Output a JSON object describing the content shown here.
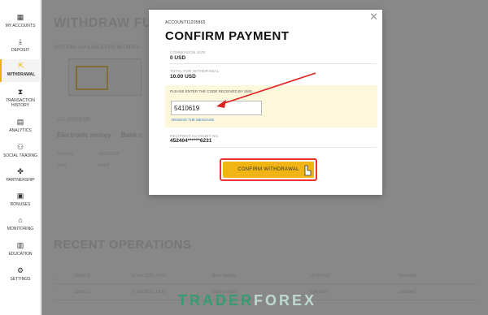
{
  "sidebar": {
    "items": [
      {
        "label": "MY ACCOUNTS",
        "icon": "grid-icon"
      },
      {
        "label": "DEPOSIT",
        "icon": "download-icon"
      },
      {
        "label": "WITHDRAWAL",
        "icon": "withdrawal-icon",
        "active": true
      },
      {
        "label": "TRANSACTION HISTORY",
        "icon": "hourglass-icon"
      },
      {
        "label": "ANALYTICS",
        "icon": "chat-icon"
      },
      {
        "label": "SOCIAL TRADING",
        "icon": "people-icon"
      },
      {
        "label": "PARTNERSHIP",
        "icon": "handshake-icon"
      },
      {
        "label": "BONUSES",
        "icon": "gift-icon"
      },
      {
        "label": "MONITORING",
        "icon": "monitor-icon"
      },
      {
        "label": "EDUCATION",
        "icon": "book-icon"
      },
      {
        "label": "SETTINGS",
        "icon": "gear-icon"
      }
    ]
  },
  "background": {
    "title": "WITHDRAW FU",
    "systems_available": "SYSTEMS AVAILABLE FOR WITHDRA",
    "all_systems": "ALL SYSTEMS",
    "tab_electronic": "Electronic money",
    "tab_bank": "Bank c",
    "methods": [
      "FasaPay",
      "NETELLER",
      "Skrill",
      "Ebank"
    ],
    "recent_operations": "RECENT OPERATIONS",
    "table_rows": [
      {
        "id": "1924673",
        "date": "18 Jan 2021, 10:41",
        "method": "Bank transfer",
        "amount": "10.00 USD",
        "status": "Accepted"
      },
      {
        "id": "1908512",
        "date": "07 Jan 2021, 19:11",
        "method": "Bank transfer",
        "amount": "5.00 USD",
        "status": "Declined"
      }
    ]
  },
  "modal": {
    "account": "ACCOUNT11205865",
    "title": "CONFIRM PAYMENT",
    "commission_label": "COMMISSION SIZE",
    "commission_value": "0 USD",
    "total_label": "TOTAL FOR WITHDRAWAL",
    "total_value": "10.00 USD",
    "sms_label": "PLEASE ENTER THE CODE RECEIVED BY SMS",
    "sms_value": "5410619",
    "resend": "RESEND THE MESSAGE",
    "recipient_label": "RECIPIENT ACCOUNT NO.",
    "recipient_value": "452404******6231",
    "confirm_button": "CONFIRM WITHDRAWAL",
    "close_icon": "close-icon"
  },
  "watermark": {
    "part1": "TRADER",
    "part2": "FOREX"
  },
  "colors": {
    "accent": "#f0b514",
    "highlight": "#e33333",
    "link": "#3a7bbf"
  }
}
